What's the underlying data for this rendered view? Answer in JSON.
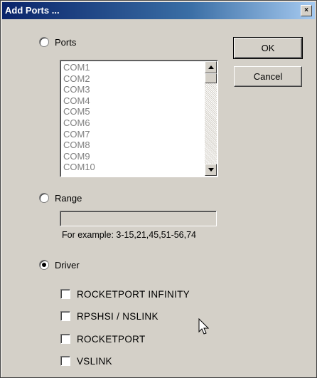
{
  "window": {
    "title": "Add Ports ...",
    "close_label": "×"
  },
  "ports": {
    "label": "Ports",
    "checked": false,
    "items": [
      "COM1",
      "COM2",
      "COM3",
      "COM4",
      "COM5",
      "COM6",
      "COM7",
      "COM8",
      "COM9",
      "COM10"
    ]
  },
  "buttons": {
    "ok": "OK",
    "cancel": "Cancel"
  },
  "range": {
    "label": "Range",
    "checked": false,
    "value": "",
    "example": "For example: 3-15,21,45,51-56,74"
  },
  "driver": {
    "label": "Driver",
    "checked": true,
    "options": [
      {
        "label": "ROCKETPORT INFINITY",
        "checked": false
      },
      {
        "label": "RPSHSI / NSLINK",
        "checked": false
      },
      {
        "label": "ROCKETPORT",
        "checked": false
      },
      {
        "label": "VSLINK",
        "checked": false
      }
    ]
  },
  "icons": {
    "scroll_up": "up-arrow-icon",
    "scroll_down": "down-arrow-icon",
    "cursor": "mouse-pointer-icon"
  }
}
